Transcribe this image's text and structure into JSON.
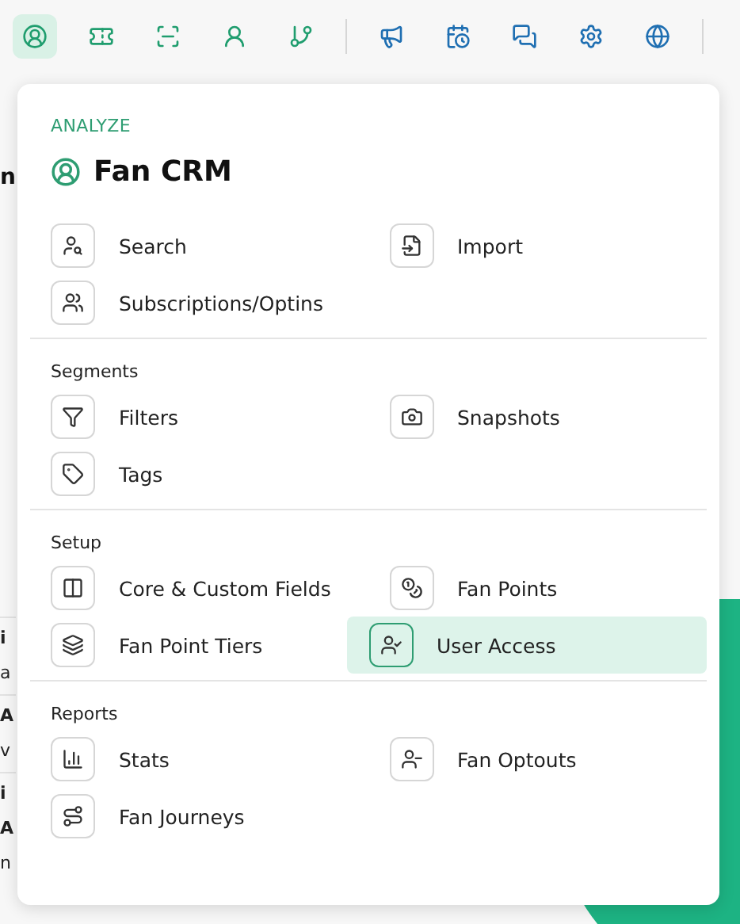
{
  "toolbar": {
    "groups": [
      {
        "color": "#1f9d6e",
        "items": [
          {
            "selected": true
          },
          {
            "selected": false
          },
          {
            "selected": false
          },
          {
            "selected": false
          },
          {
            "selected": false
          }
        ]
      },
      {
        "color": "#1f6fb2",
        "items": [
          {
            "selected": false
          },
          {
            "selected": false
          },
          {
            "selected": false
          },
          {
            "selected": false
          },
          {
            "selected": false
          }
        ]
      }
    ]
  },
  "background": {
    "heading": "n",
    "rows": [
      {
        "lines": [
          "i",
          "a"
        ]
      },
      {
        "lines": [
          "A",
          "v"
        ]
      },
      {
        "lines": [
          "i",
          "A",
          "n"
        ]
      }
    ]
  },
  "menu": {
    "eyebrow": "ANALYZE",
    "title": "Fan CRM",
    "sections": [
      {
        "items": [
          {
            "label": "Search",
            "selected": false
          },
          {
            "label": "Import",
            "selected": false
          },
          {
            "label": "Subscriptions/Optins",
            "selected": false
          }
        ]
      },
      {
        "heading": "Segments",
        "items": [
          {
            "label": "Filters",
            "selected": false
          },
          {
            "label": "Snapshots",
            "selected": false
          },
          {
            "label": "Tags",
            "selected": false
          }
        ]
      },
      {
        "heading": "Setup",
        "items": [
          {
            "label": "Core & Custom Fields",
            "selected": false
          },
          {
            "label": "Fan Points",
            "selected": false
          },
          {
            "label": "Fan Point Tiers",
            "selected": false
          },
          {
            "label": "User Access",
            "selected": true
          }
        ]
      },
      {
        "heading": "Reports",
        "items": [
          {
            "label": "Stats",
            "selected": false
          },
          {
            "label": "Fan Optouts",
            "selected": false
          },
          {
            "label": "Fan Journeys",
            "selected": false
          }
        ]
      }
    ]
  }
}
